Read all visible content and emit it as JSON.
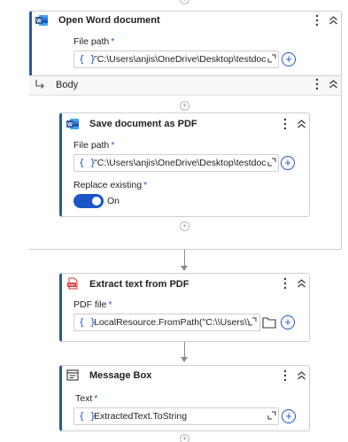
{
  "open_word": {
    "title": "Open Word document",
    "file_path_label": "File path",
    "required": "*",
    "file_path_value": "\"C:\\Users\\anjis\\OneDrive\\Desktop\\testdoc",
    "braces": "{ }"
  },
  "body": {
    "label": "Body"
  },
  "save_pdf": {
    "title": "Save document as PDF",
    "file_path_label": "File path",
    "required": "*",
    "file_path_value": "\"C:\\Users\\anjis\\OneDrive\\Desktop\\testdoc",
    "braces": "{ }",
    "replace_label": "Replace existing",
    "toggle_value": "On"
  },
  "extract_text": {
    "title": "Extract text from PDF",
    "pdf_file_label": "PDF file",
    "required": "*",
    "pdf_file_value": "LocalResource.FromPath(\"C:\\\\Users\\\\",
    "braces": "{ }"
  },
  "message_box": {
    "title": "Message Box",
    "text_label": "Text",
    "required": "*",
    "text_value": "ExtractedText.ToString",
    "braces": "{ }"
  },
  "colors": {
    "accent": "#1a56c7",
    "word_blue": "#2b579a",
    "pdf_red": "#d9302c",
    "border": "#cfcfcf"
  },
  "icons": [
    "word-icon",
    "pdf-icon",
    "message-box-icon",
    "kebab-icon",
    "chevron-up-icon",
    "expand-icon",
    "plus-icon",
    "folder-icon",
    "body-arrow-icon"
  ]
}
